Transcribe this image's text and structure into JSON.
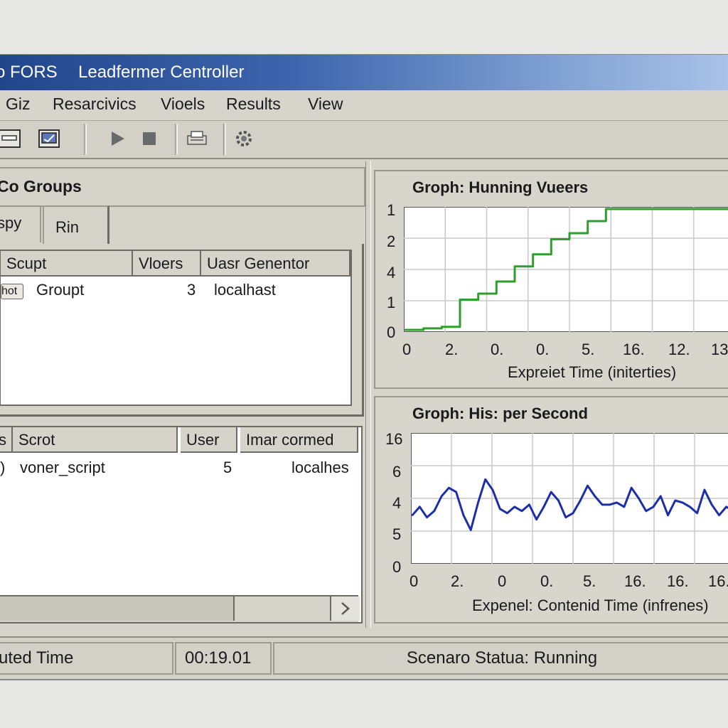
{
  "window": {
    "app_name": "o FORS",
    "title": "Leadfermer Centroller"
  },
  "menu": [
    "Giz",
    "Resarcivics",
    "Vioels",
    "Results",
    "View"
  ],
  "toolbar": {
    "icons": [
      "panel-icon",
      "open-icon",
      "play-icon",
      "stop-icon",
      "printer-icon",
      "settings-gear-icon"
    ]
  },
  "groups": {
    "title": "Co Groups",
    "tabs": [
      "spy",
      "Rin"
    ],
    "table": {
      "headers": [
        "Scupt",
        "Vloers",
        "Uasr Genentor"
      ],
      "rows": [
        {
          "badge": "hot",
          "script": "Groupt",
          "users": "3",
          "generator": "localhast"
        }
      ]
    }
  },
  "scripts": {
    "table": {
      "headers": [
        "s",
        "Scrot",
        "User",
        "Imar cormed"
      ],
      "rows": [
        {
          "icon": ")",
          "script": "voner_script",
          "users": "5",
          "generator": "localhes"
        }
      ]
    }
  },
  "graph1": {
    "title": "Groph: Hunning Vueers",
    "y_ticks": [
      "1",
      "2",
      "4",
      "1",
      "0"
    ],
    "x_ticks": [
      "0",
      "2.",
      "0.",
      "0.",
      "5.",
      "16.",
      "12.",
      "13"
    ],
    "xlabel": "Expreiet Time (initerties)"
  },
  "graph2": {
    "title": "Groph: His: per Second",
    "y_ticks": [
      "16",
      "6",
      "4",
      "5",
      "0"
    ],
    "x_ticks": [
      "0",
      "2.",
      "0",
      "0.",
      "5.",
      "16.",
      "16.",
      "16."
    ],
    "xlabel": "Expenel: Contenid Time (infrenes)"
  },
  "chart_data": [
    {
      "type": "line",
      "title": "Groph: Hunning Vueers",
      "xlabel": "Expreiet Time (initerties)",
      "color": "#2e9e2e",
      "x": [
        0,
        1,
        2,
        3,
        4,
        5,
        6,
        7,
        8,
        9,
        10,
        11,
        12,
        13,
        14,
        15,
        16,
        17,
        18
      ],
      "values": [
        0,
        0.05,
        0.1,
        1,
        1.2,
        1.6,
        2.1,
        2.5,
        3.0,
        3.2,
        3.6,
        4.0,
        4.0,
        4.0,
        4.0,
        4.0,
        4.0,
        4.0,
        4.0
      ],
      "ylim": [
        0,
        4
      ],
      "grid": true
    },
    {
      "type": "line",
      "title": "Groph: His: per Second",
      "xlabel": "Expenel: Contenid Time (infrenes)",
      "color": "#1c2fa8",
      "values": [
        2.2,
        2.6,
        2.1,
        2.4,
        3.1,
        3.5,
        3.3,
        2.2,
        1.5,
        2.8,
        3.9,
        3.4,
        2.5,
        2.3,
        2.6,
        2.4,
        2.7,
        2.0,
        2.6,
        3.3,
        2.9,
        2.1,
        2.3,
        2.9,
        3.6,
        3.1,
        2.7,
        2.7,
        2.8,
        2.6,
        3.5,
        3.0,
        2.4,
        2.6,
        3.1,
        2.2,
        2.9,
        2.8,
        2.6,
        2.3,
        3.4,
        2.7,
        2.2,
        2.6,
        2.4
      ],
      "ylim": [
        0,
        6
      ],
      "grid": true
    }
  ],
  "status": {
    "elapsed_label": "uted Time",
    "elapsed_value": "00:19.01",
    "scenario_status": "Scenaro Statua: Running"
  }
}
